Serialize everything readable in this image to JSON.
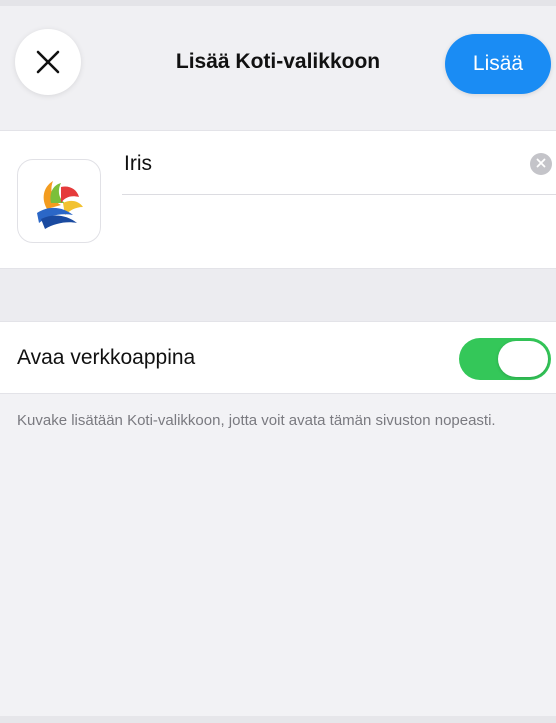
{
  "header": {
    "title": "Lisää Koti-valikkoon",
    "add_label": "Lisää",
    "close_icon": "close-icon"
  },
  "name_field": {
    "value": "Iris",
    "clear_icon": "clear-icon",
    "app_icon": "iris-app-icon"
  },
  "web_app_toggle": {
    "label": "Avaa verkkoappina",
    "enabled": true
  },
  "footnote": "Kuvake lisätään Koti-valikkoon, jotta voit avata tämän sivuston nopeasti.",
  "colors": {
    "accent": "#1a8cf4",
    "toggle_on": "#34c759",
    "background": "#f2f2f5"
  }
}
